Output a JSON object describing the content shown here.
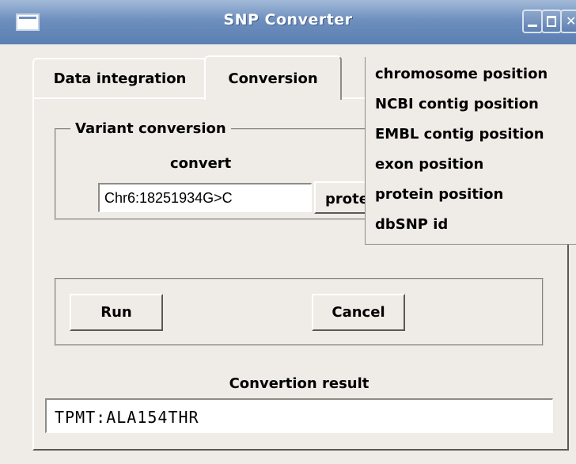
{
  "window": {
    "title": "SNP Converter"
  },
  "tabs": [
    {
      "label": "Data integration"
    },
    {
      "label": "Conversion"
    }
  ],
  "variant_group": {
    "legend": "Variant conversion",
    "convert_label": "convert",
    "input_value": "Chr6:18251934G>C",
    "target_selected": "prote"
  },
  "dropdown": {
    "options": [
      "chromosome position",
      "NCBI contig position",
      "EMBL contig position",
      "exon position",
      "protein position",
      "dbSNP id"
    ]
  },
  "buttons": {
    "run": "Run",
    "cancel": "Cancel"
  },
  "result": {
    "label": "Convertion result",
    "value": "TPMT:ALA154THR"
  },
  "icons": {
    "app": "window-icon",
    "minimize": "minimize-icon",
    "maximize": "maximize-icon",
    "close": "close-icon"
  },
  "colors": {
    "titlebar": "#6d8fbe",
    "background": "#efebe7"
  }
}
